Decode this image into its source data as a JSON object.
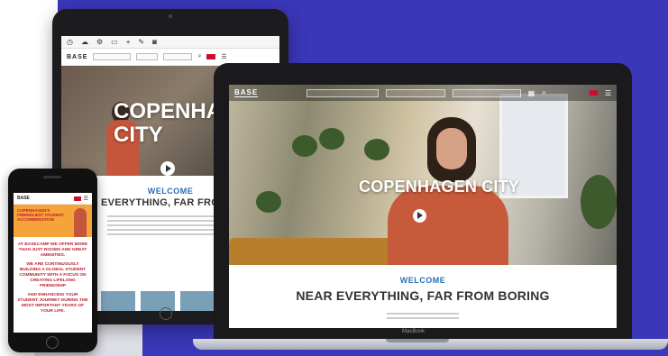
{
  "tablet": {
    "brand": "BASE",
    "hero_title": "COPENHAGEN CITY",
    "welcome": "WELCOME",
    "tagline": "NEAR EVERYTHING, FAR FROM BORING"
  },
  "laptop": {
    "brand": "BASE",
    "hero_title": "COPENHAGEN CITY",
    "welcome": "WELCOME",
    "tagline": "NEAR EVERYTHING, FAR FROM BORING",
    "device_label": "MacBook"
  },
  "phone": {
    "brand": "BASE",
    "banner_title": "COPENHAGEN'S FRIENDLIEST STUDENT ACCOMMODATION",
    "paragraphs": [
      "AT BASECAMP WE OFFER MORE THAN JUST ROOMS AND GREAT AMENITIES.",
      "WE ARE CONTINUOUSLY BUILDING A GLOBAL STUDENT COMMUNITY WITH A FOCUS ON CREATING LIFELONG FRIENDSHIP",
      "AND ENHANCING YOUR STUDENT JOURNEY DURING THE MOST IMPORTANT YEARS OF YOUR LIFE."
    ]
  },
  "colors": {
    "background_panel": "#3a37b8",
    "welcome_blue": "#2a6fb7",
    "phone_banner": "#f5a43a",
    "phone_text_red": "#b71f2e"
  }
}
